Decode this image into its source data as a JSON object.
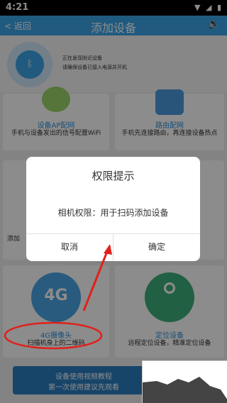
{
  "status_bar": {
    "time": "4:21"
  },
  "header": {
    "title": "添加设备",
    "back_label": "返回"
  },
  "scan": {
    "line1": "正在发现附近设备",
    "line2": "请确保设备已接入电源并开机"
  },
  "cards": [
    {
      "title": "设备AP配网",
      "desc": "手机与设备发出的信号配置WiFi"
    },
    {
      "title": "路由配网",
      "desc": "手机先连接路由，再连接设备热点"
    },
    {
      "title": "4G摄像头",
      "desc": "扫描机身上的二维码"
    },
    {
      "title": "定位设备",
      "desc": "远程定位设备，精准定位设备"
    }
  ],
  "partial_left_label": "添加",
  "dialog": {
    "title": "权限提示",
    "message": "相机权限：用于扫码添加设备",
    "cancel": "取消",
    "confirm": "确定"
  },
  "footer": {
    "line1": "设备使用视频教程",
    "line2": "第一次使用建议先观看"
  },
  "colors": {
    "accent": "#3ba5e8",
    "annotation": "#e0201c"
  }
}
